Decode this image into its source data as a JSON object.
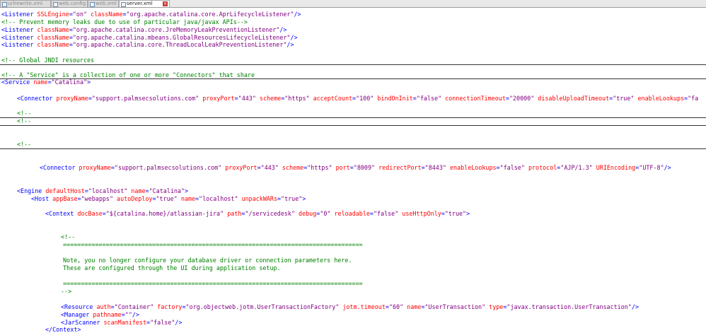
{
  "tabs": [
    {
      "label": "urlrewrite.xml",
      "active": false,
      "icon": "xml-file-icon"
    },
    {
      "label": "web.config",
      "active": false,
      "icon": "config-file-icon"
    },
    {
      "label": "web.xml",
      "active": false,
      "icon": "xml-file-icon"
    },
    {
      "label": "server.xml",
      "active": true,
      "icon": "xml-file-icon",
      "close_icon": "close-icon"
    }
  ],
  "code": {
    "l1": {
      "tag": "<Listener",
      "attr1": "SSLEngine",
      "val1": "\"on\"",
      "attr2": "className",
      "val2": "\"org.apache.catalina.core.AprLifecycleListener\"",
      "end": "/>"
    },
    "l2": {
      "comment": "<!-- Prevent memory leaks due to use of particular java/javax APIs-->"
    },
    "l3": {
      "tag": "<Listener",
      "attr1": "className",
      "val1": "\"org.apache.catalina.core.JreMemoryLeakPreventionListener\"",
      "end": "/>"
    },
    "l4": {
      "tag": "<Listener",
      "attr1": "className",
      "val1": "\"org.apache.catalina.mbeans.GlobalResourcesLifecycleListener\"",
      "end": "/>"
    },
    "l5": {
      "tag": "<Listener",
      "attr1": "className",
      "val1": "\"org.apache.catalina.core.ThreadLocalLeakPreventionListener\"",
      "end": "/>"
    },
    "l6": {
      "comment": "<!-- Global JNDI resources"
    },
    "l7": {
      "comment": "<!-- A \"Service\" is a collection of one or more \"Connectors\" that share"
    },
    "l8": {
      "tag": "<Service",
      "attr1": "name",
      "val1": "\"Catalina\"",
      "end": ">"
    },
    "l9": {
      "tag": "<Connector",
      "attrs": [
        {
          "name": "proxyName",
          "value": "\"support.palmsecsolutions.com\""
        },
        {
          "name": "proxyPort",
          "value": "\"443\""
        },
        {
          "name": "scheme",
          "value": "\"https\""
        },
        {
          "name": "acceptCount",
          "value": "\"100\""
        },
        {
          "name": "bindOnInit",
          "value": "\"false\""
        },
        {
          "name": "connectionTimeout",
          "value": "\"20000\""
        },
        {
          "name": "disableUploadTimeout",
          "value": "\"true\""
        },
        {
          "name": "enableLookups",
          "value": "\"fa"
        }
      ]
    },
    "l10": {
      "comment": "<!--"
    },
    "l11": {
      "comment": "<!--"
    },
    "l12": {
      "comment": "<!--"
    },
    "l13": {
      "tag": "<Connector",
      "attrs": [
        {
          "name": "proxyName",
          "value": "\"support.palmsecsolutions.com\""
        },
        {
          "name": "proxyPort",
          "value": "\"443\""
        },
        {
          "name": "scheme",
          "value": "\"https\""
        },
        {
          "name": "port",
          "value": "\"8009\""
        },
        {
          "name": "redirectPort",
          "value": "\"8443\""
        },
        {
          "name": "enableLookups",
          "value": "\"false\""
        },
        {
          "name": "protocol",
          "value": "\"AJP/1.3\""
        },
        {
          "name": "URIEncoding",
          "value": "\"UTF-8\""
        }
      ],
      "end": "/>"
    },
    "l14": {
      "tag": "<Engine",
      "attr1": "defaultHost",
      "val1": "\"localhost\"",
      "attr2": "name",
      "val2": "\"Catalina\"",
      "end": ">"
    },
    "l15": {
      "tag": "<Host",
      "attr1": "appBase",
      "val1": "\"webapps\"",
      "attr2": "autoDeploy",
      "val2": "\"true\"",
      "attr3": "name",
      "val3": "\"localhost\"",
      "attr4": "unpackWARs",
      "val4": "\"true\"",
      "end": ">"
    },
    "l16": {
      "tag": "<Context",
      "attrs": [
        {
          "name": "docBase",
          "value": "\"${catalina.home}/atlassian-jira\""
        },
        {
          "name": "path",
          "value": "\"/servicedesk\""
        },
        {
          "name": "debug",
          "value": "\"0\""
        },
        {
          "name": "reloadable",
          "value": "\"false\""
        },
        {
          "name": "useHttpOnly",
          "value": "\"true\""
        }
      ],
      "end": ">"
    },
    "l17": {
      "comment": "<!--"
    },
    "l18": {
      "comment": "===================================================================================="
    },
    "l19": {
      "comment": "Note, you no longer configure your database driver or connection parameters here."
    },
    "l20": {
      "comment": "These are configured through the UI during application setup."
    },
    "l21": {
      "comment": "===================================================================================="
    },
    "l22": {
      "comment": "-->"
    },
    "l23": {
      "tag": "<Resource",
      "attrs": [
        {
          "name": "auth",
          "value": "\"Container\""
        },
        {
          "name": "factory",
          "value": "\"org.objectweb.jotm.UserTransactionFactory\""
        },
        {
          "name": "jotm.timeout",
          "value": "\"60\""
        },
        {
          "name": "name",
          "value": "\"UserTransaction\""
        },
        {
          "name": "type",
          "value": "\"javax.transaction.UserTransaction\""
        }
      ],
      "end": "/>"
    },
    "l24": {
      "tag": "<Manager",
      "attr1": "pathname",
      "val1": "\"\"",
      "end": "/>"
    },
    "l25": {
      "tag": "<JarScanner",
      "attr1": "scanManifest",
      "val1": "\"false\"",
      "end": "/>"
    },
    "l26": {
      "tag": "</Context>"
    }
  },
  "colors": {
    "tag": "#0000ff",
    "attribute": "#ff0000",
    "value": "#800080",
    "comment": "#008000",
    "tab_close": "#c43c3c"
  }
}
